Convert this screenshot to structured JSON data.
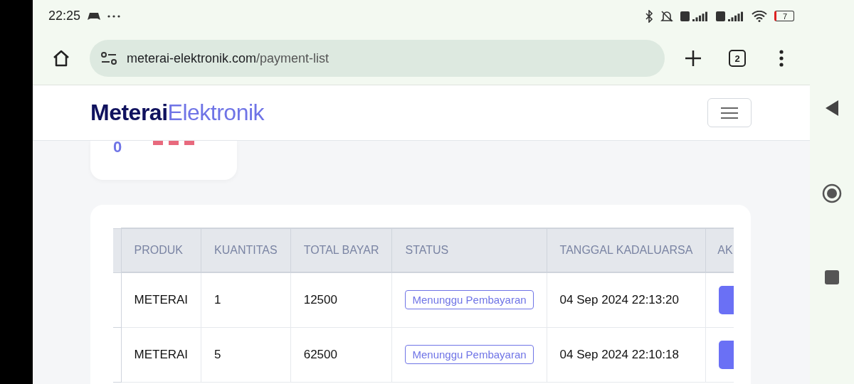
{
  "status_bar": {
    "time": "22:25",
    "battery": "7"
  },
  "browser": {
    "url_domain": "meterai-elektronik.com",
    "url_path": "/payment-list",
    "tab_count": "2"
  },
  "site": {
    "logo_bold": "Meterai",
    "logo_light": "Elektronik"
  },
  "summary_card": {
    "value": "0"
  },
  "table": {
    "columns": [
      "PRODUK",
      "KUANTITAS",
      "TOTAL BAYAR",
      "STATUS",
      "TANGGAL KADALUARSA",
      "AK"
    ],
    "rows": [
      {
        "product": "METERAI",
        "quantity": "1",
        "total": "12500",
        "status": "Menunggu Pembayaran",
        "expiry": "04 Sep 2024 22:13:20"
      },
      {
        "product": "METERAI",
        "quantity": "5",
        "total": "62500",
        "status": "Menunggu Pembayaran",
        "expiry": "04 Sep 2024 22:10:18"
      }
    ]
  }
}
